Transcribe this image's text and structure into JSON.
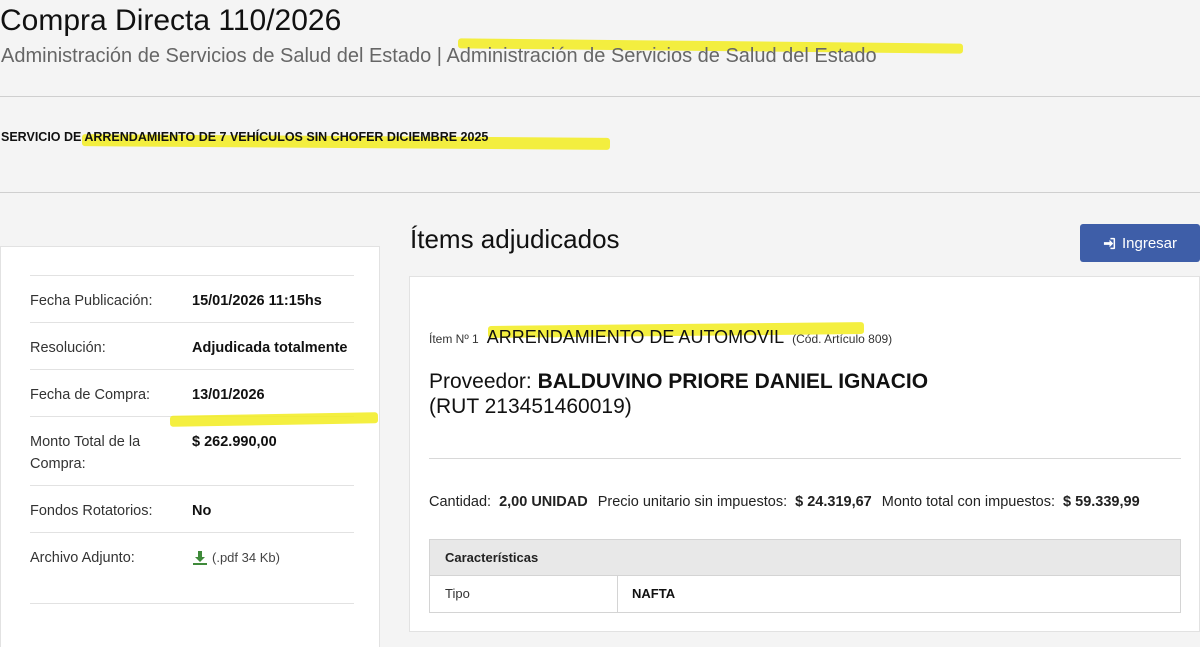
{
  "header": {
    "title": "Compra Directa 110/2026",
    "subtitle": "Administración de Servicios de Salud del Estado | Administración de Servicios de Salud del Estado"
  },
  "service": {
    "description": "SERVICIO DE ARRENDAMIENTO DE 7 VEHÍCULOS SIN CHOFER DICIEMBRE 2025"
  },
  "details": {
    "rows": [
      {
        "label": "Fecha Publicación:",
        "value": "15/01/2026 11:15hs"
      },
      {
        "label": "Resolución:",
        "value": "Adjudicada totalmente"
      },
      {
        "label": "Fecha de Compra:",
        "value": "13/01/2026"
      },
      {
        "label": "Monto Total de la Compra:",
        "value": "$ 262.990,00"
      },
      {
        "label": "Fondos Rotatorios:",
        "value": "No"
      },
      {
        "label": "Archivo Adjunto:",
        "value": "(.pdf 34 Kb)"
      }
    ],
    "attachment_icon": "download-icon"
  },
  "items": {
    "section_title": "Ítems adjudicados",
    "login_button": "Ingresar",
    "login_icon": "sign-in-icon",
    "item_number": "Ítem Nº 1",
    "item_name": "ARRENDAMIENTO DE AUTOMOVIL",
    "item_code": "(Cód. Artículo 809)",
    "provider_label": "Proveedor:",
    "provider_name": "BALDUVINO PRIORE DANIEL IGNACIO",
    "provider_rut": "(RUT 213451460019)",
    "quantity_label": "Cantidad:",
    "quantity_value": "2,00 UNIDAD",
    "unit_price_label": "Precio unitario sin impuestos:",
    "unit_price_value": "$ 24.319,67",
    "total_label": "Monto total con impuestos:",
    "total_value": "$ 59.339,99",
    "features_header": "Características",
    "features": [
      {
        "key": "Tipo",
        "value": "NAFTA"
      }
    ]
  },
  "colors": {
    "highlight": "#f2ec1e",
    "button": "#3e5ea8"
  }
}
